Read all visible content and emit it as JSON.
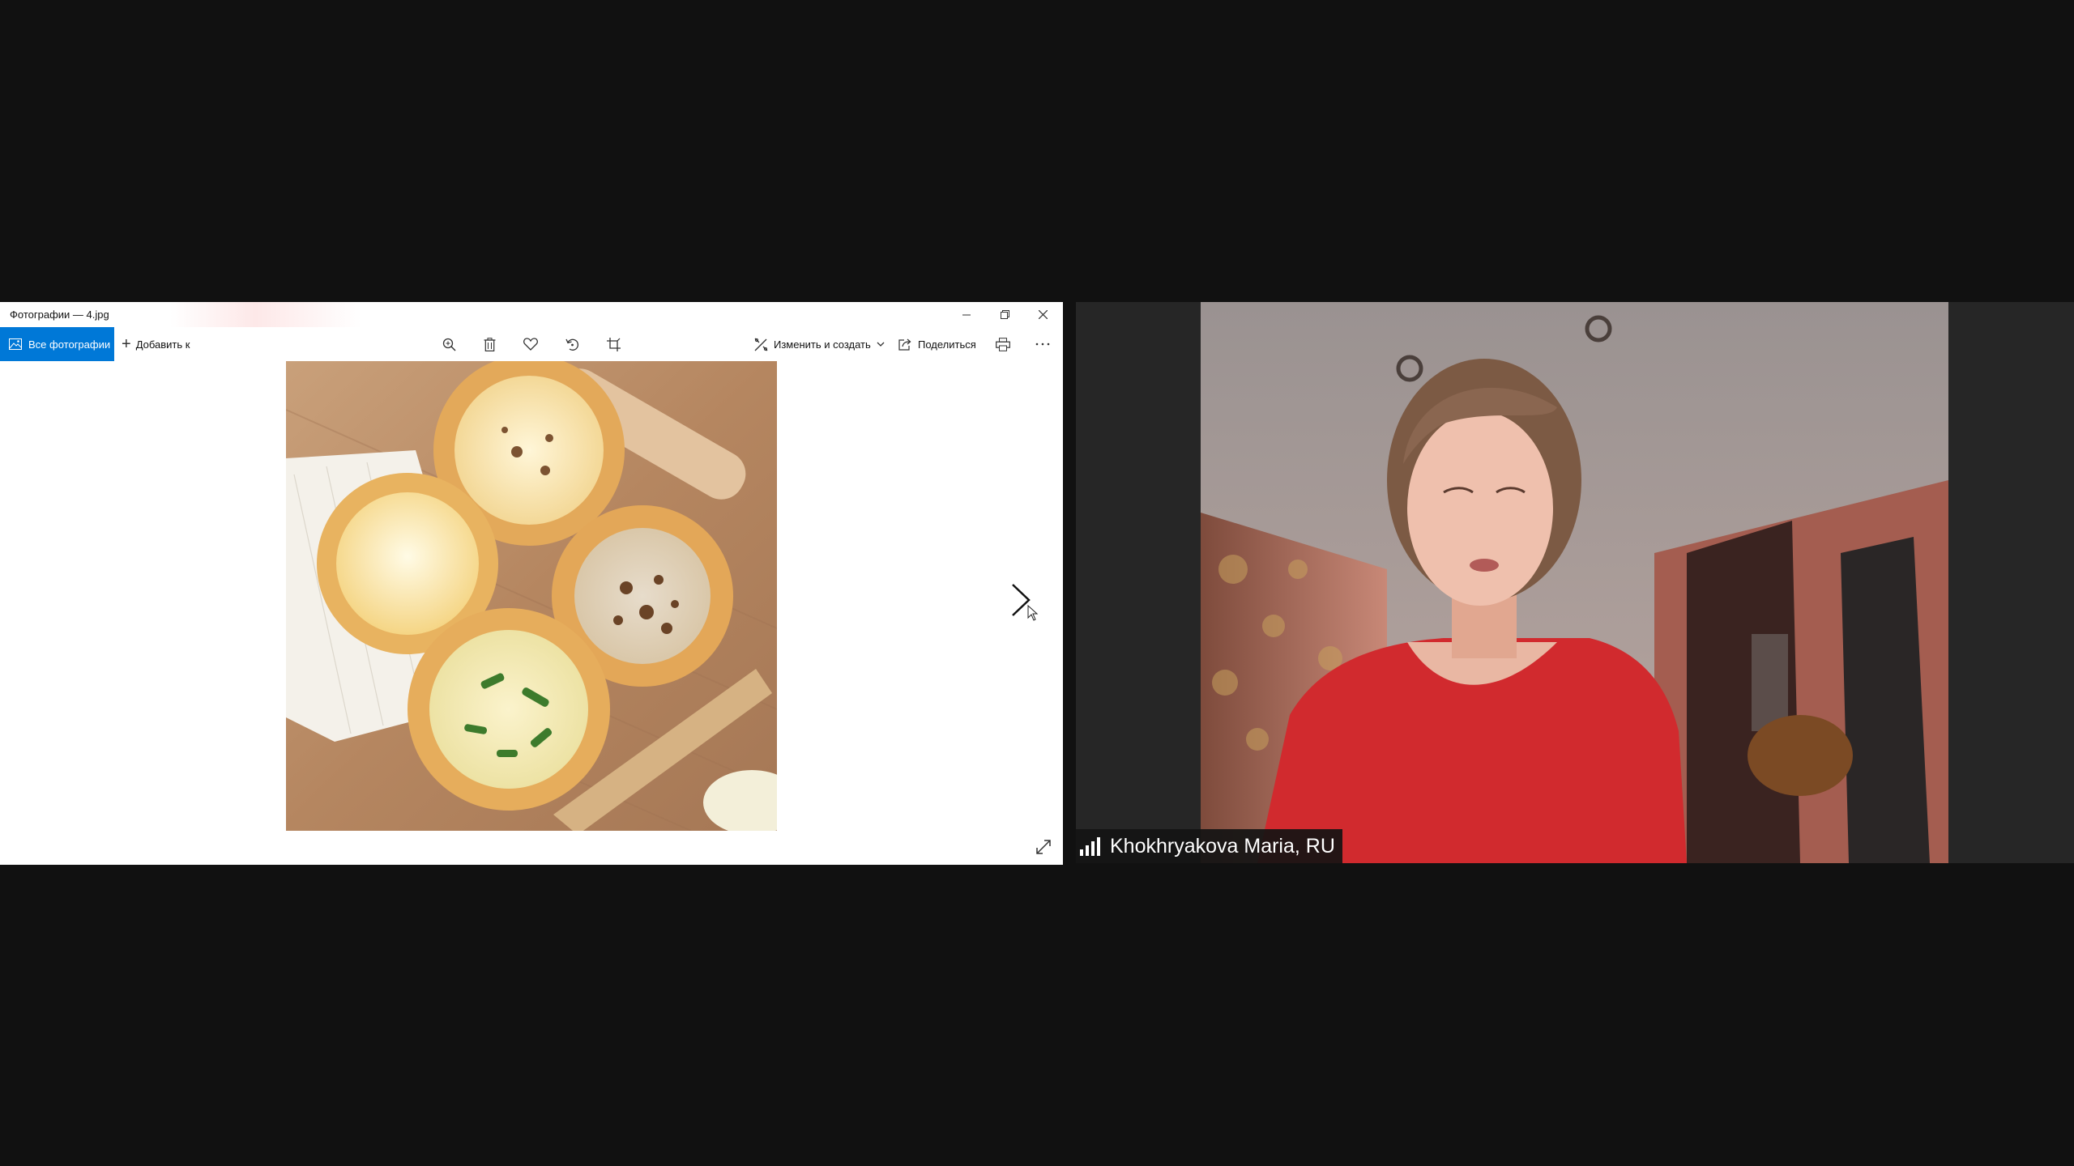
{
  "photos_app": {
    "window_title": "Фотографии — 4.jpg",
    "window_controls": {
      "minimize_icon": "minimize-icon",
      "restore_icon": "restore-icon",
      "close_icon": "close-icon"
    },
    "toolbar": {
      "all_photos_label": "Все фотографии",
      "add_to_label": "Добавить к",
      "edit_create_label": "Изменить и создать",
      "share_label": "Поделиться",
      "icons": [
        "zoom-icon",
        "delete-icon",
        "favorite-icon",
        "rotate-icon",
        "crop-icon",
        "print-icon",
        "more-icon"
      ]
    },
    "accent_color": "#0078d7"
  },
  "meeting": {
    "participant_name": "Khokhryakova Maria, RU"
  }
}
